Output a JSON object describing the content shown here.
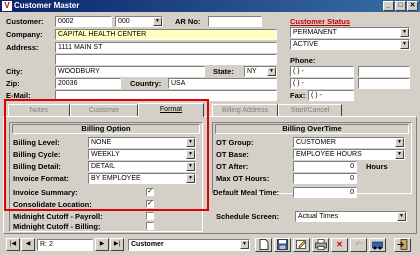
{
  "window": {
    "title": "Customer Master",
    "app_icon": "V",
    "min": "_",
    "max": "□",
    "close": "✕"
  },
  "header": {
    "customer_label": "Customer:",
    "customer_no": "0002",
    "customer_suffix": "000",
    "ar_label": "AR No:",
    "ar_no": "",
    "company_label": "Company:",
    "company": "CAPITAL HEALTH CENTER",
    "address_label": "Address:",
    "address1": "1111 MAIN ST",
    "address2": "",
    "city_label": "City:",
    "city": "WOODBURY",
    "state_label": "State:",
    "state": "NY",
    "zip_label": "Zip:",
    "zip": "20036",
    "country_label": "Country:",
    "country": "USA",
    "email_label": "E-Mail:",
    "email": ""
  },
  "status": {
    "title": "Customer Status",
    "type": "PERMANENT",
    "state": "ACTIVE"
  },
  "phone": {
    "label": "Phone:",
    "phone1": "(   )   -",
    "phone2": "(   )   -",
    "fax_label": "Fax:",
    "fax": "(   )   -"
  },
  "tabs": [
    "Notes",
    "Customer",
    "Format",
    "Billing Address",
    "Start/Cancel"
  ],
  "billing_option": {
    "header": "Billing Option",
    "level_label": "Billing Level:",
    "level": "NONE",
    "cycle_label": "Billing Cycle:",
    "cycle": "WEEKLY",
    "detail_label": "Billing Detail:",
    "detail": "DETAIL",
    "invoice_format_label": "Invoice Format:",
    "invoice_format": "BY EMPLOYEE",
    "invoice_summary_label": "Invoice Summary:",
    "consolidate_label": "Consolidate Location:",
    "midnight_payroll_label": "Midnight Cutoff - Payroll:",
    "midnight_billing_label": "Midnight Cutoff - Billing:",
    "check_mark": "✓"
  },
  "billing_overtime": {
    "header": "Billing OverTime",
    "group_label": "OT Group:",
    "group": "CUSTOMER",
    "base_label": "OT Base:",
    "base": "EMPLOYEE HOURS",
    "after_label": "OT After:",
    "after": "0",
    "hours_label": "Hours",
    "max_label": "Max OT Hours:",
    "max": "0",
    "meal_label": "Default Meal Time:",
    "meal": "0",
    "schedule_label": "Schedule Screen:",
    "schedule": "Actual Times"
  },
  "navbar": {
    "record": "R: 2",
    "table": "Customer",
    "first": "|◀",
    "prev": "◀",
    "next": "▶",
    "last": "▶|"
  }
}
